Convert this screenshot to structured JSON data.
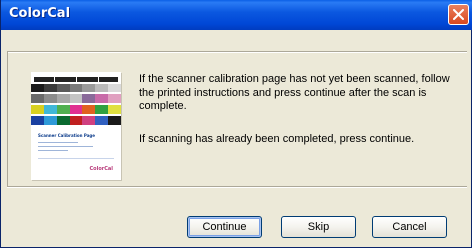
{
  "window": {
    "title": "ColorCal"
  },
  "message": {
    "line1": "If the scanner calibration page has not yet been scanned, follow the printed instructions and press continue after the scan is complete.",
    "line2": "If scanning has already been completed, press continue."
  },
  "thumbnail": {
    "page_title": "Scanner Calibration Page",
    "logo": "ColorCal",
    "gray_swatches": [
      "#1a1a1a",
      "#3a3a3a",
      "#5a5a5a",
      "#7a7a7a",
      "#9a9a9a",
      "#bababa",
      "#dadada"
    ],
    "color_row_1": [
      "#6a6a6a",
      "#8c8c8c",
      "#a8a8a8",
      "#c4c4c4",
      "#8a6a9a",
      "#c86aa8",
      "#e0a0c0"
    ],
    "color_row_2": [
      "#d8d020",
      "#40b8d8",
      "#50b050",
      "#e03090",
      "#e06020",
      "#30a040",
      "#e0e040"
    ],
    "color_row_3": [
      "#1a40a0",
      "#2f9ad8",
      "#0a6a30",
      "#c02020",
      "#d04080",
      "#3060c0",
      "#1a1a1a"
    ]
  },
  "buttons": {
    "continue": "Continue",
    "skip": "Skip",
    "cancel": "Cancel"
  }
}
